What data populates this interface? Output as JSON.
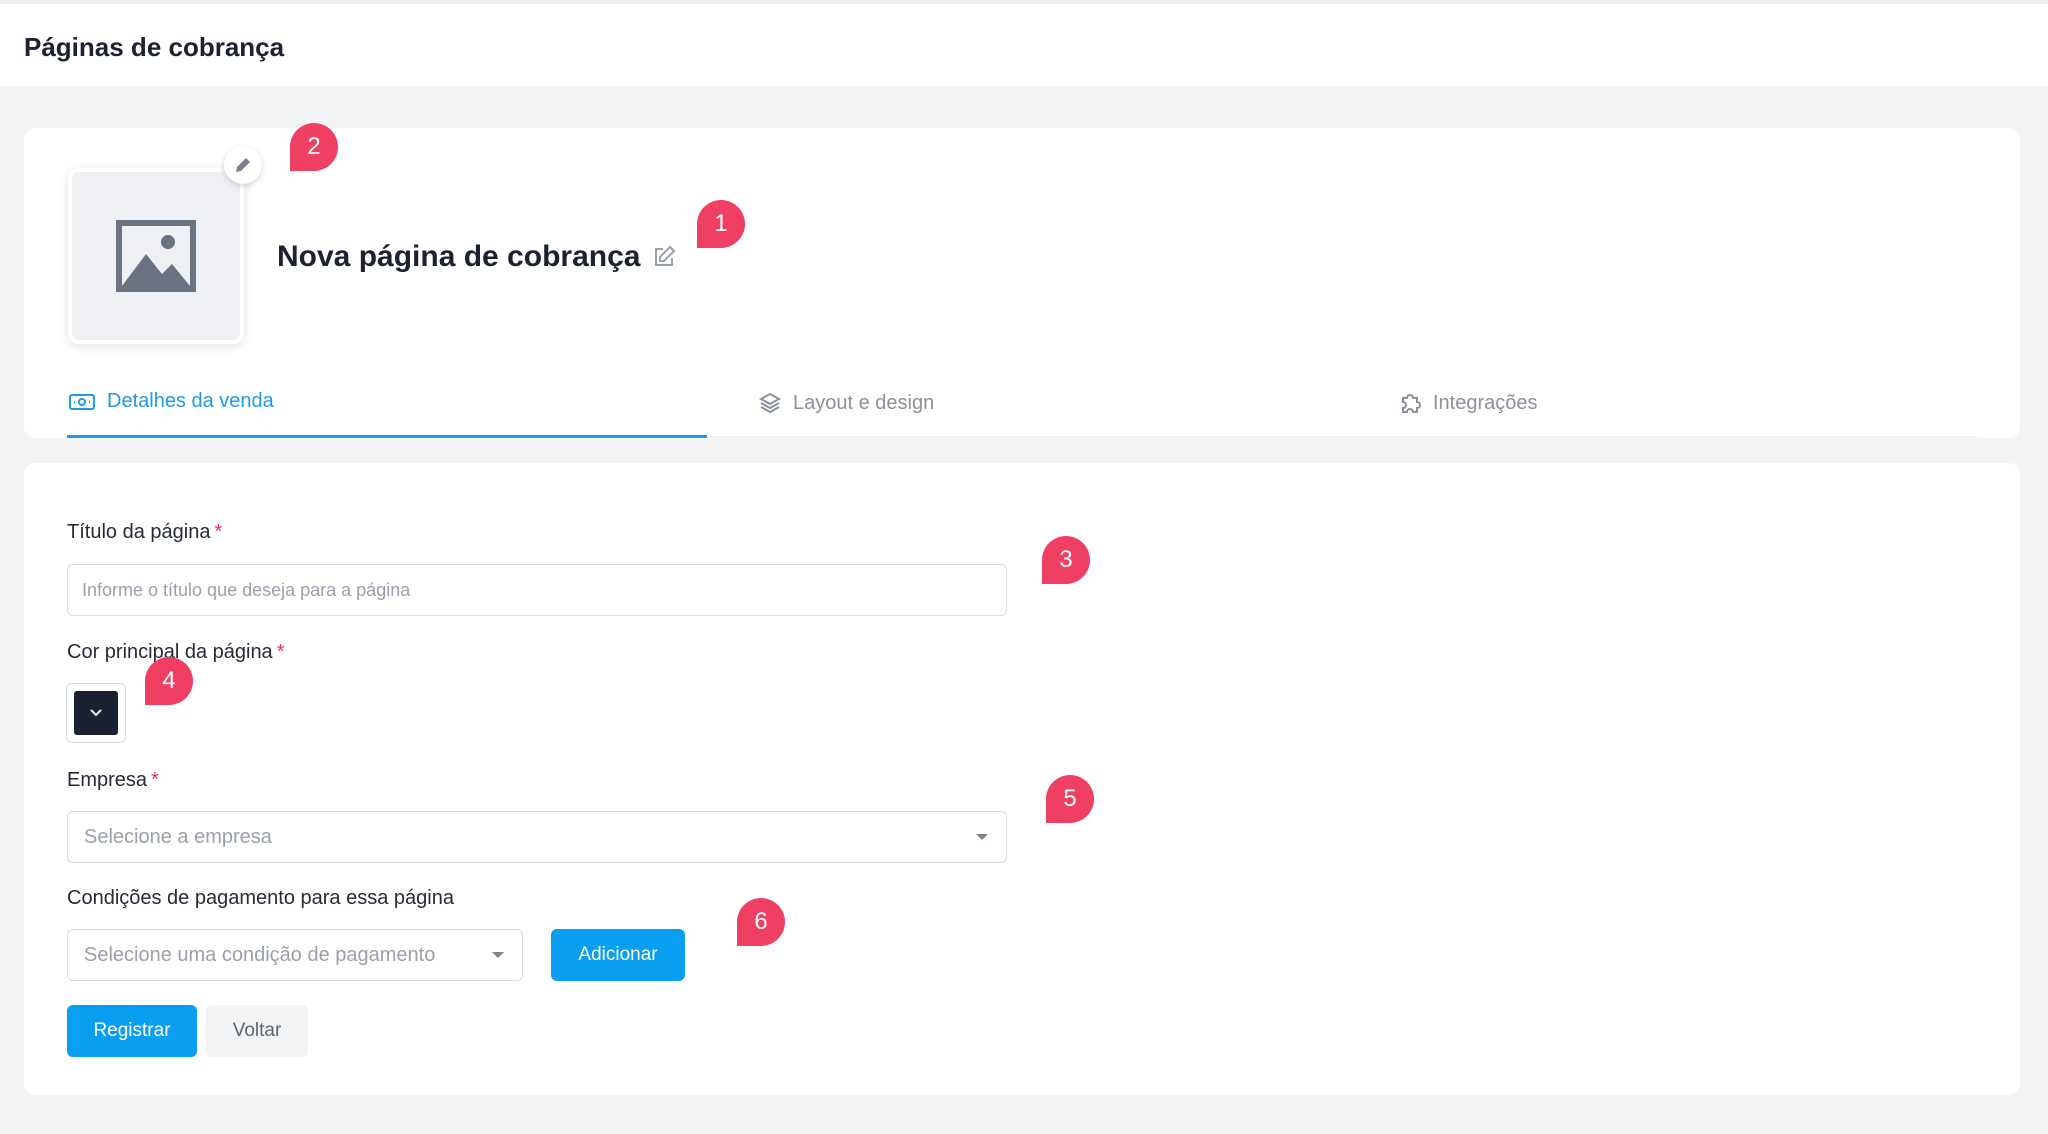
{
  "topbar": {
    "title": "Páginas de cobrança"
  },
  "header": {
    "page_name": "Nova página de cobrança",
    "avatar_icon": "image-placeholder-icon",
    "tabs": [
      {
        "label": "Detalhes da venda",
        "icon": "banknote-icon",
        "active": true
      },
      {
        "label": "Layout e design",
        "icon": "layers-icon",
        "active": false
      },
      {
        "label": "Integrações",
        "icon": "puzzle-icon",
        "active": false
      }
    ]
  },
  "form": {
    "title_label": "Título da página",
    "title_placeholder": "Informe o título que deseja para a página",
    "color_label": "Cor principal da página",
    "color_value": "#1b2033",
    "company_label": "Empresa",
    "company_placeholder": "Selecione a empresa",
    "payment_label": "Condições de pagamento para essa página",
    "payment_placeholder": "Selecione uma condição de pagamento",
    "add_label": "Adicionar",
    "required_mark": "*",
    "register_label": "Registrar",
    "back_label": "Voltar"
  },
  "markers": [
    "1",
    "2",
    "3",
    "4",
    "5",
    "6"
  ],
  "colors": {
    "accent": "#0a9ef0",
    "marker": "#ef3f63",
    "tab_active": "#1e9ae8"
  }
}
